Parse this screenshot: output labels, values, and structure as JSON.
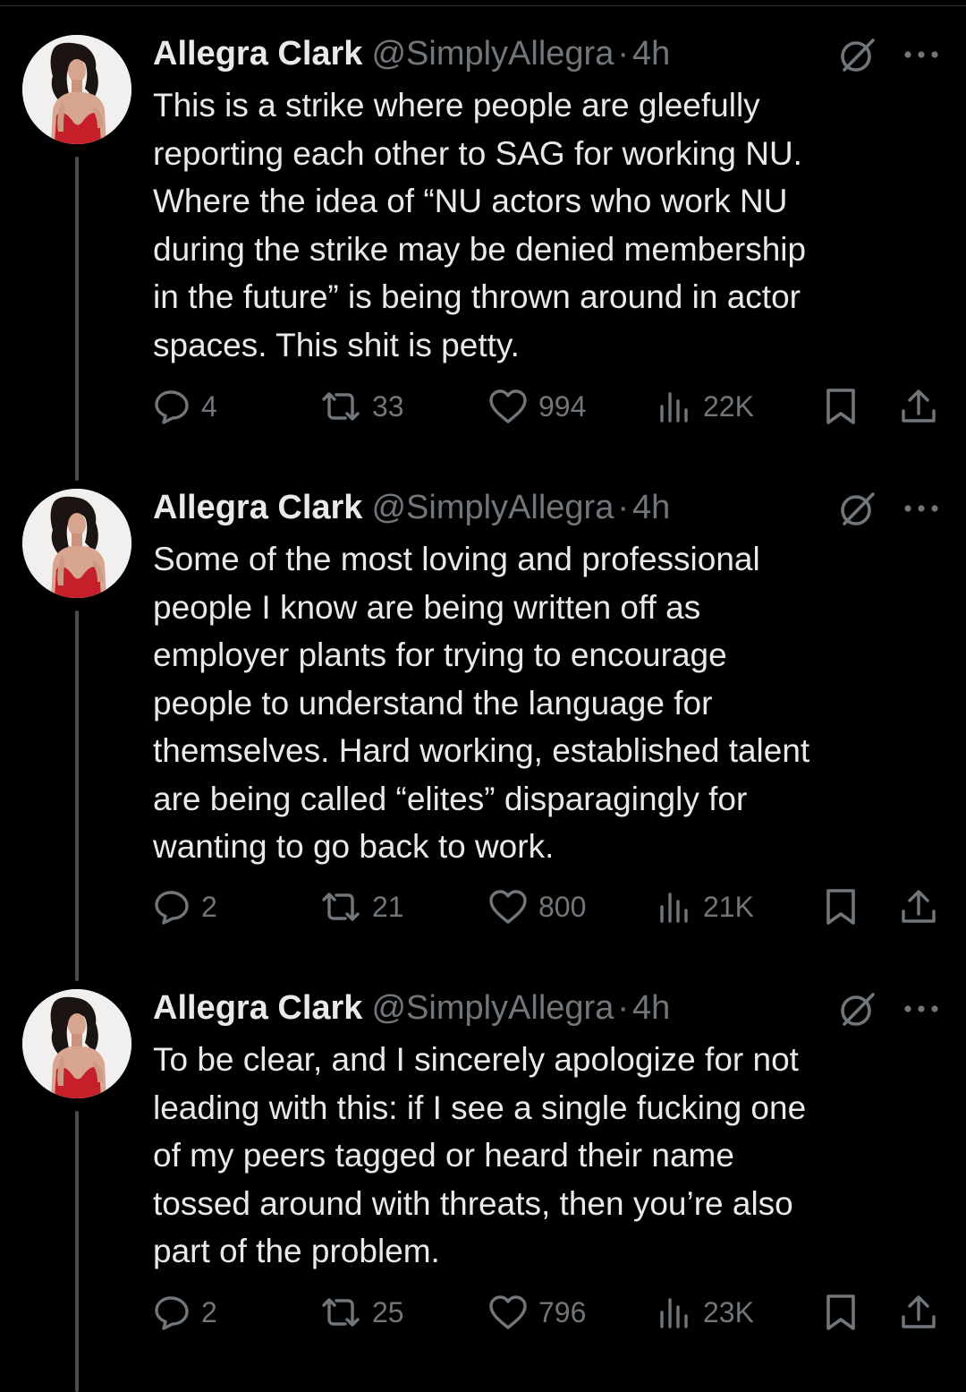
{
  "colors": {
    "background": "#000000",
    "text_primary": "#e7e9ea",
    "text_secondary": "#71767b",
    "thread_line": "#4a4d50"
  },
  "icons": {
    "reply": "speech-bubble-icon",
    "retweet": "retweet-arrows-icon",
    "like": "heart-icon",
    "views": "bar-chart-icon",
    "bookmark": "bookmark-icon",
    "share": "upload-share-icon",
    "grok": "grok-slash-circle-icon",
    "more": "ellipsis-icon"
  },
  "tweets": [
    {
      "name": "Allegra Clark",
      "handle": "@SimplyAllegra",
      "separator": "·",
      "time": "4h",
      "text": "This is a strike where people are gleefully\nreporting each other to SAG for working NU.\nWhere the idea of “NU actors who work NU\nduring the strike may be denied membership\nin the future” is being thrown around in actor\nspaces. This shit is petty.",
      "replies": "4",
      "retweets": "33",
      "likes": "994",
      "views": "22K"
    },
    {
      "name": "Allegra Clark",
      "handle": "@SimplyAllegra",
      "separator": "·",
      "time": "4h",
      "text": "Some of the most loving and professional\npeople I know are being written off as\nemployer plants for trying to encourage\npeople to understand the language for\nthemselves. Hard working, established talent\nare being called “elites” disparagingly for\nwanting to go back to work.",
      "replies": "2",
      "retweets": "21",
      "likes": "800",
      "views": "21K"
    },
    {
      "name": "Allegra Clark",
      "handle": "@SimplyAllegra",
      "separator": "·",
      "time": "4h",
      "text": "To be clear, and I sincerely apologize for not\nleading with this: if I see a single fucking one\nof my peers tagged or heard their name\ntossed around with threats, then you’re also\npart of the problem.",
      "replies": "2",
      "retweets": "25",
      "likes": "796",
      "views": "23K"
    }
  ]
}
